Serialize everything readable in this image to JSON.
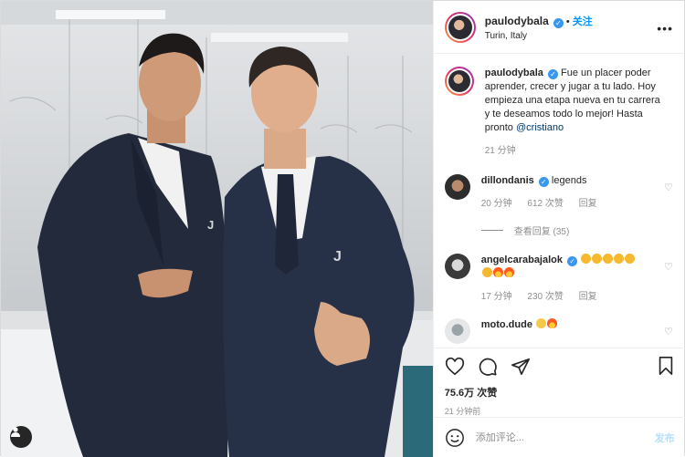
{
  "header": {
    "username": "paulodybala",
    "follow_label": "关注",
    "location": "Turin, Italy",
    "more_label": "•••"
  },
  "caption": {
    "username": "paulodybala",
    "text": "Fue un placer poder aprender, crecer y jugar a tu lado. Hoy empieza una etapa nueva en tu carrera y te deseamos todo lo mejor! Hasta pronto ",
    "mention": "@cristiano",
    "time": "21 分钟"
  },
  "comments": [
    {
      "username": "dillondanis",
      "verified": true,
      "text": "legends",
      "time": "20 分钟",
      "likes": "612 次赞",
      "reply": "回复",
      "view_replies": "查看回复 (35)"
    },
    {
      "username": "angelcarabajalok",
      "verified": true,
      "text": "",
      "time": "17 分钟",
      "likes": "230 次赞",
      "reply": "回复"
    },
    {
      "username": "moto.dude",
      "verified": false,
      "text": ""
    }
  ],
  "actions": {
    "likes": "75.6万 次赞",
    "posted_ago": "21 分钟前"
  },
  "comment_box": {
    "placeholder": "添加评论...",
    "post_label": "发布"
  },
  "icons": [
    "heart-icon",
    "comment-icon",
    "share-icon",
    "bookmark-icon",
    "emoji-icon",
    "user-tag-icon",
    "verified-icon"
  ],
  "colors": {
    "link": "#0095f6",
    "verified": "#3897f0",
    "muted": "#8e8e8e",
    "post_disabled": "#b2dffc"
  }
}
